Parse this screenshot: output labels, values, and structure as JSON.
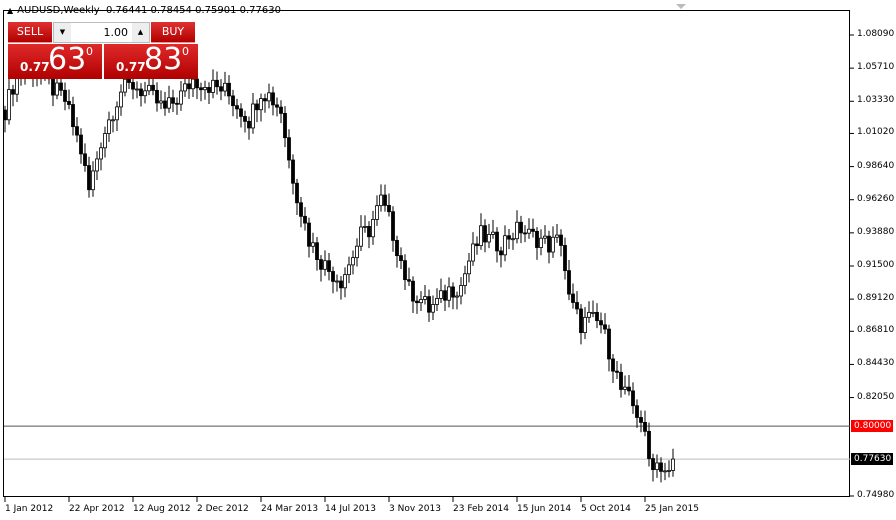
{
  "header": {
    "symbol": "AUDUSD,Weekly",
    "ohlc": "0.76441 0.78454 0.75901 0.77630"
  },
  "trade_panel": {
    "sell_label": "SELL",
    "buy_label": "BUY",
    "lots": "1.00",
    "sell_price": {
      "prefix": "0.77",
      "big": "63",
      "sup": "0"
    },
    "buy_price": {
      "prefix": "0.77",
      "big": "83",
      "sup": "0"
    }
  },
  "colors": {
    "trade": "#c00000",
    "candle": "#000000",
    "level_tag": "#ff0000",
    "current_tag": "#000000"
  },
  "chart_data": {
    "type": "candlestick",
    "title": "AUDUSD,Weekly",
    "ylim": [
      0.7498,
      1.0809
    ],
    "y_ticks": [
      "1.08090",
      "1.05710",
      "1.03330",
      "1.01020",
      "0.98640",
      "0.96260",
      "0.93880",
      "0.91500",
      "0.89120",
      "0.86810",
      "0.84430",
      "0.82050",
      "0.74980"
    ],
    "x_ticks": [
      "1 Jan 2012",
      "22 Apr 2012",
      "12 Aug 2012",
      "2 Dec 2012",
      "24 Mar 2013",
      "14 Jul 2013",
      "3 Nov 2013",
      "23 Feb 2014",
      "15 Jun 2014",
      "5 Oct 2014",
      "25 Jan 2015"
    ],
    "x_tick_weeks": [
      0,
      16,
      32,
      48,
      64,
      80,
      96,
      112,
      128,
      144,
      160
    ],
    "close_anchors": [
      [
        0,
        1.027
      ],
      [
        2.5,
        1.049
      ],
      [
        6,
        1.059
      ],
      [
        11,
        1.045
      ],
      [
        15,
        1.034
      ],
      [
        19,
        0.998
      ],
      [
        21,
        0.969
      ],
      [
        24,
        1.005
      ],
      [
        26,
        1.02
      ],
      [
        29,
        1.041
      ],
      [
        32,
        1.045
      ],
      [
        36,
        1.038
      ],
      [
        40,
        1.027
      ],
      [
        44,
        1.038
      ],
      [
        47,
        1.049
      ],
      [
        51,
        1.045
      ],
      [
        55,
        1.041
      ],
      [
        59,
        1.027
      ],
      [
        61,
        1.02
      ],
      [
        64,
        1.041
      ],
      [
        66,
        1.038
      ],
      [
        69,
        1.027
      ],
      [
        71,
        0.991
      ],
      [
        74,
        0.955
      ],
      [
        76,
        0.934
      ],
      [
        79,
        0.919
      ],
      [
        81,
        0.912
      ],
      [
        84,
        0.905
      ],
      [
        86,
        0.916
      ],
      [
        89,
        0.937
      ],
      [
        91,
        0.941
      ],
      [
        94,
        0.962
      ],
      [
        96,
        0.948
      ],
      [
        99,
        0.919
      ],
      [
        101,
        0.898
      ],
      [
        104,
        0.891
      ],
      [
        106,
        0.884
      ],
      [
        109,
        0.891
      ],
      [
        111,
        0.898
      ],
      [
        114,
        0.901
      ],
      [
        116,
        0.919
      ],
      [
        119,
        0.937
      ],
      [
        121,
        0.934
      ],
      [
        124,
        0.93
      ],
      [
        126,
        0.937
      ],
      [
        129,
        0.942
      ],
      [
        131,
        0.937
      ],
      [
        134,
        0.934
      ],
      [
        136,
        0.93
      ],
      [
        139,
        0.934
      ],
      [
        141,
        0.891
      ],
      [
        144,
        0.873
      ],
      [
        146,
        0.877
      ],
      [
        149,
        0.873
      ],
      [
        151,
        0.855
      ],
      [
        154,
        0.826
      ],
      [
        156,
        0.819
      ],
      [
        159,
        0.805
      ],
      [
        161,
        0.776
      ],
      [
        164,
        0.772
      ],
      [
        166,
        0.765
      ],
      [
        167,
        0.7763
      ]
    ],
    "levels": [
      {
        "value": "0.80000",
        "type": "alert"
      },
      {
        "value": "0.77630",
        "type": "current"
      }
    ]
  }
}
